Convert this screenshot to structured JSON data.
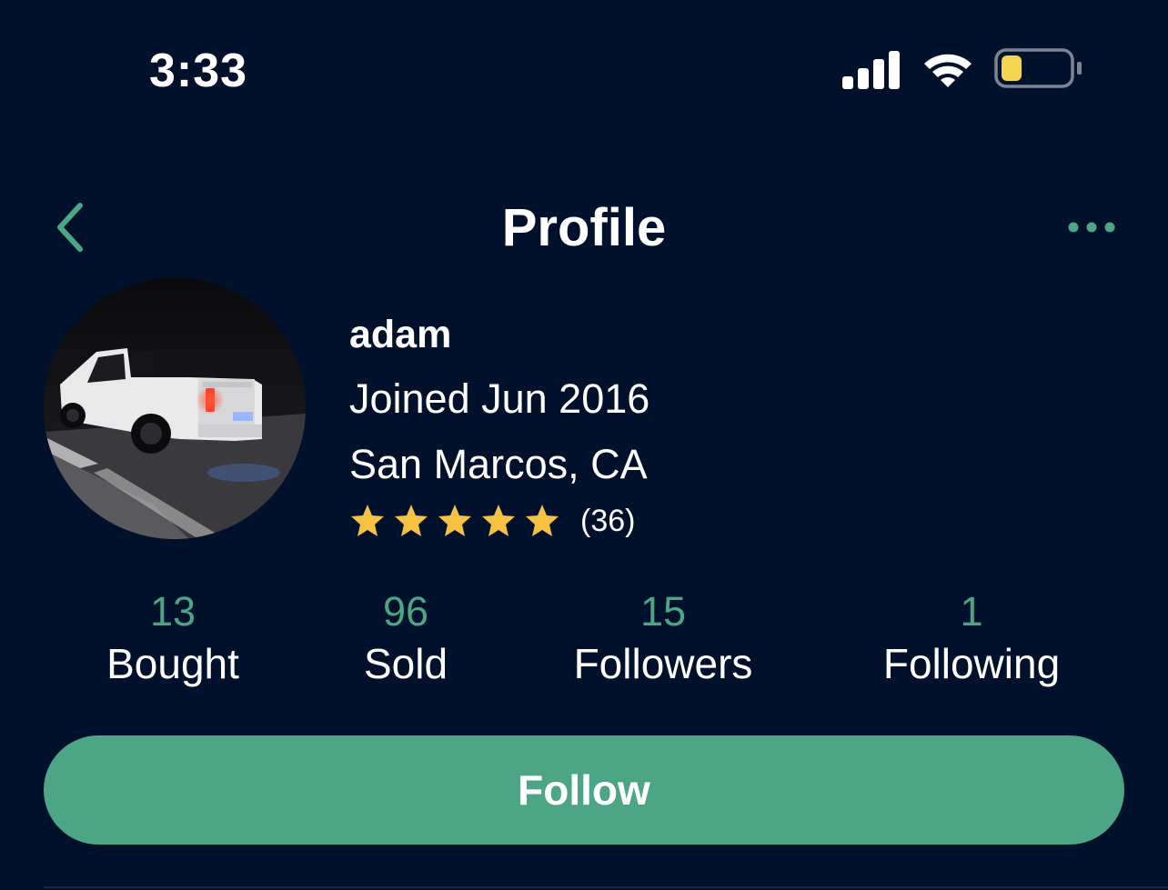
{
  "status_bar": {
    "time": "3:33",
    "icons": [
      "cellular-signal-icon",
      "wifi-icon",
      "battery-low-icon"
    ],
    "battery_color": "#f3d551"
  },
  "nav": {
    "title": "Profile",
    "back_icon": "chevron-left-icon",
    "more_icon": "ellipsis-icon",
    "accent_color": "#4ca584"
  },
  "profile": {
    "name": "adam",
    "joined": "Joined Jun 2016",
    "location": "San Marcos, CA",
    "rating_stars": 5,
    "rating_count": "(36)",
    "star_color": "#f5c242",
    "avatar_description": "avatar photo"
  },
  "stats": [
    {
      "value": "13",
      "label": "Bought"
    },
    {
      "value": "96",
      "label": "Sold"
    },
    {
      "value": "15",
      "label": "Followers"
    },
    {
      "value": "1",
      "label": "Following"
    }
  ],
  "follow_button": {
    "label": "Follow",
    "color": "#4ca584"
  },
  "colors": {
    "background": "#02112b",
    "text": "#ffffff",
    "accent": "#4ca584"
  }
}
